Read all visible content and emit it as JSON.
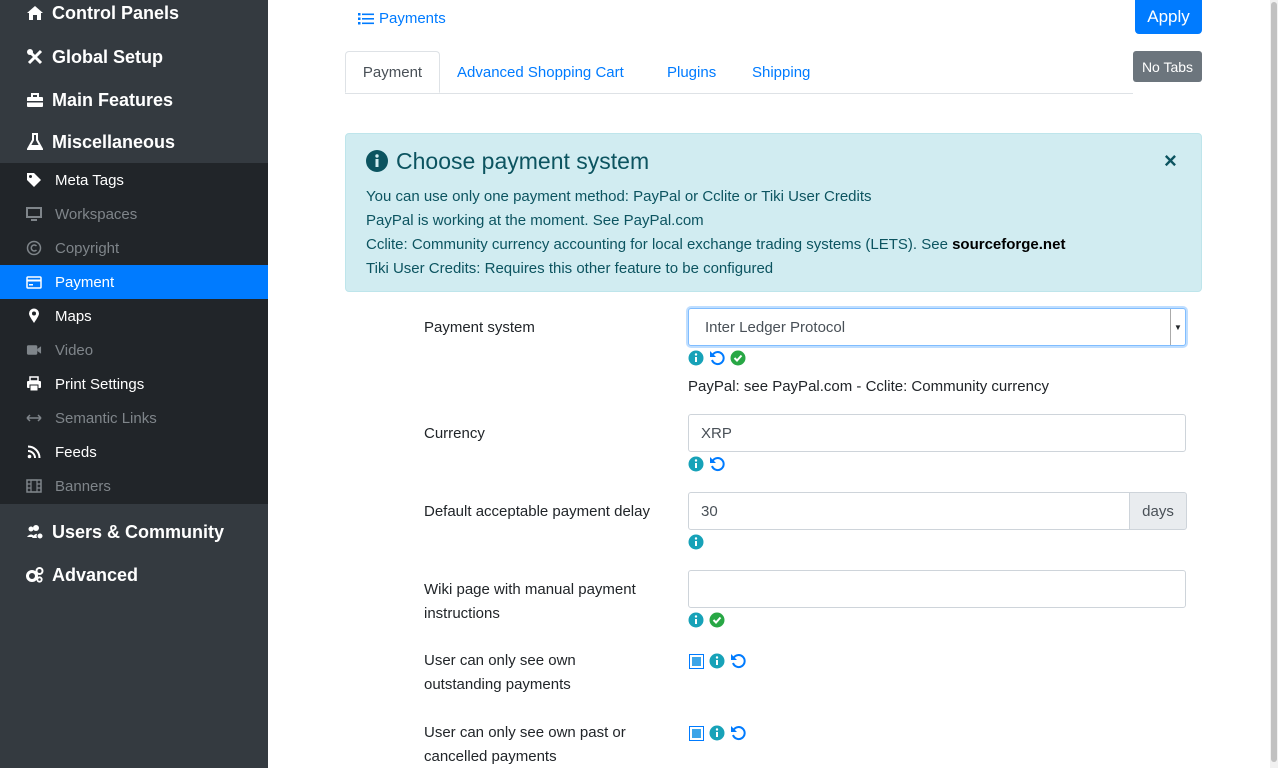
{
  "sidebar": {
    "top_items": [
      {
        "label": "Control Panels",
        "icon": "home-icon"
      },
      {
        "label": "Global Setup",
        "icon": "tools-icon"
      },
      {
        "label": "Main Features",
        "icon": "briefcase-icon"
      },
      {
        "label": "Miscellaneous",
        "icon": "flask-icon"
      }
    ],
    "sub_items": [
      {
        "label": "Meta Tags",
        "icon": "tag-icon",
        "state": "normal"
      },
      {
        "label": "Workspaces",
        "icon": "desktop-icon",
        "state": "disabled"
      },
      {
        "label": "Copyright",
        "icon": "copyright-icon",
        "state": "disabled"
      },
      {
        "label": "Payment",
        "icon": "credit-card-icon",
        "state": "active"
      },
      {
        "label": "Maps",
        "icon": "map-marker-icon",
        "state": "normal"
      },
      {
        "label": "Video",
        "icon": "video-icon",
        "state": "disabled"
      },
      {
        "label": "Print Settings",
        "icon": "print-icon",
        "state": "normal"
      },
      {
        "label": "Semantic Links",
        "icon": "arrows-h-icon",
        "state": "disabled"
      },
      {
        "label": "Feeds",
        "icon": "rss-icon",
        "state": "normal"
      },
      {
        "label": "Banners",
        "icon": "film-icon",
        "state": "disabled"
      }
    ],
    "bottom_items": [
      {
        "label": "Users & Community",
        "icon": "users-cog-icon"
      },
      {
        "label": "Advanced",
        "icon": "cogs-icon"
      }
    ]
  },
  "header": {
    "payments_link": "Payments",
    "apply_label": "Apply",
    "no_tabs_label": "No Tabs"
  },
  "tabs": [
    "Payment",
    "Advanced Shopping Cart",
    "Plugins",
    "Shipping"
  ],
  "alert": {
    "title": "Choose payment system",
    "line1": "You can use only one payment method: PayPal or Cclite or Tiki User Credits",
    "line2": "PayPal is working at the moment. See PayPal.com",
    "line3": "Cclite: Community currency accounting for local exchange trading systems (LETS). See ",
    "line3_link": "sourceforge.net",
    "line4": "Tiki User Credits: Requires this other feature to be configured",
    "close": "×"
  },
  "form": {
    "payment_system": {
      "label": "Payment system",
      "value": "Inter Ledger Protocol",
      "hint": "PayPal: see PayPal.com - Cclite: Community currency"
    },
    "currency": {
      "label": "Currency",
      "value": "XRP"
    },
    "delay": {
      "label": "Default acceptable payment delay",
      "value": "30",
      "unit": "days"
    },
    "wiki_page": {
      "label": "Wiki page with manual payment instructions",
      "value": ""
    },
    "own_outstanding": {
      "label": "User can only see own outstanding payments",
      "checked": true
    },
    "own_past": {
      "label": "User can only see own past or cancelled payments",
      "checked": true
    }
  },
  "colors": {
    "accent": "#007bff",
    "sidebar": "#343a40",
    "sidebar_sub": "#212529",
    "alert_bg": "#d1ecf1",
    "alert_text": "#0c5460",
    "info": "#17a2b8",
    "success": "#28a745"
  }
}
